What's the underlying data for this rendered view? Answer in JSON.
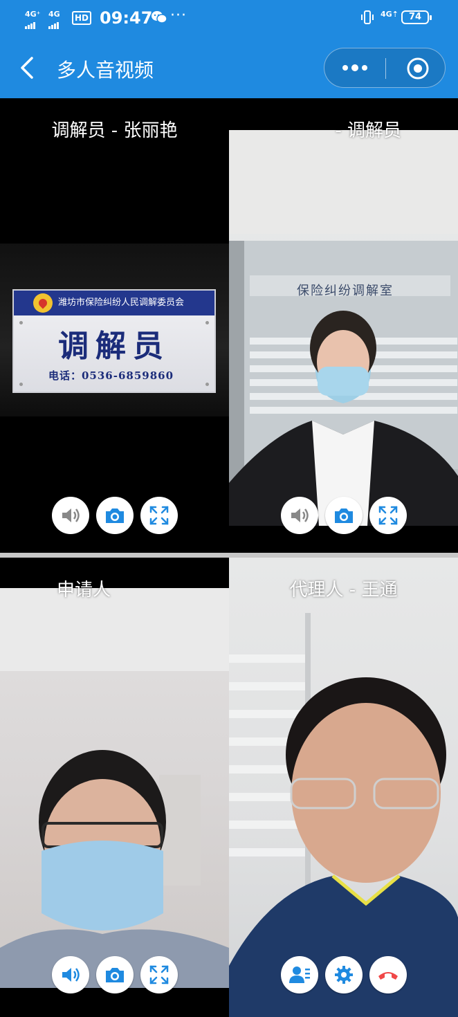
{
  "status_bar": {
    "signal_1": "4G⁺",
    "signal_2": "4G",
    "hd": "HD",
    "time": "09:47",
    "more": "···",
    "signal_right": "4G⇡",
    "battery": "74"
  },
  "nav": {
    "title": "多人音视频"
  },
  "participants": [
    {
      "label": "调解员 - 张丽艳"
    },
    {
      "label": "- 调解员"
    },
    {
      "label": "申请人"
    },
    {
      "label": "代理人 - 王通"
    }
  ],
  "sign": {
    "org": "潍坊市保险纠纷人民调解委员会",
    "title": "调解员",
    "phone": "电话：0536-6859860"
  },
  "room_sign": "保险纠纷调解室",
  "colors": {
    "header": "#1f8ae0",
    "icon_blue": "#1f8ae0",
    "hangup_red": "#f04848"
  }
}
